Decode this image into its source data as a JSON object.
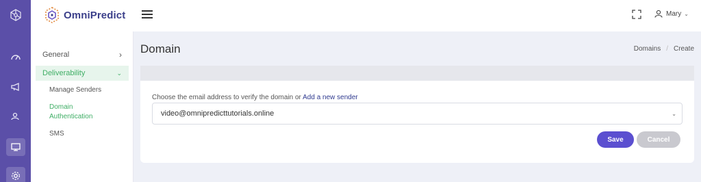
{
  "brand": {
    "name": "OmniPredict"
  },
  "header": {
    "user_name": "Mary"
  },
  "subnav": {
    "general": "General",
    "deliverability": "Deliverability",
    "sub_items": [
      "Manage Senders",
      "Domain",
      "Authentication",
      "SMS"
    ]
  },
  "page": {
    "title": "Domain",
    "breadcrumb": [
      "Domains",
      "Create"
    ]
  },
  "form": {
    "label_prefix": "Choose the email address to verify the domain or",
    "label_link": "Add a new sender",
    "selected_email": "video@omnipredicttutorials.online"
  },
  "buttons": {
    "save": "Save",
    "cancel": "Cancel"
  },
  "colors": {
    "rail": "#5b4fa8",
    "accent_green": "#3fae65",
    "save": "#5b4fd0",
    "cancel": "#c9c9cf"
  }
}
